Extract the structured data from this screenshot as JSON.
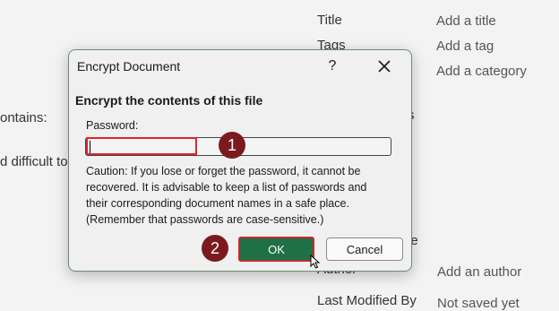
{
  "background": {
    "properties": [
      {
        "label": "Title",
        "value": "Add a title"
      },
      {
        "label": "Tags",
        "value": "Add a tag"
      },
      {
        "label": "",
        "value": "Add a category"
      }
    ],
    "left_fragments": [
      "ontains:",
      "d difficult to"
    ],
    "fragment_s": "s",
    "fragment_le": "le",
    "author": {
      "label": "Author",
      "value": "Add an author"
    },
    "last_modified": {
      "label": "Last Modified By",
      "value": "Not saved yet"
    }
  },
  "dialog": {
    "title": "Encrypt Document",
    "help": "?",
    "heading": "Encrypt the contents of this file",
    "password_label": "Password:",
    "password_value": "",
    "caution": "Caution: If you lose or forget the password, it cannot be recovered. It is advisable to keep a list of passwords and their corresponding document names in a safe place. (Remember that passwords are case-sensitive.)",
    "ok_label": "OK",
    "cancel_label": "Cancel"
  },
  "steps": [
    "1",
    "2"
  ],
  "colors": {
    "ok_button": "#1e7144",
    "highlight": "#e0242a",
    "step_badge": "#7b1a1e"
  }
}
